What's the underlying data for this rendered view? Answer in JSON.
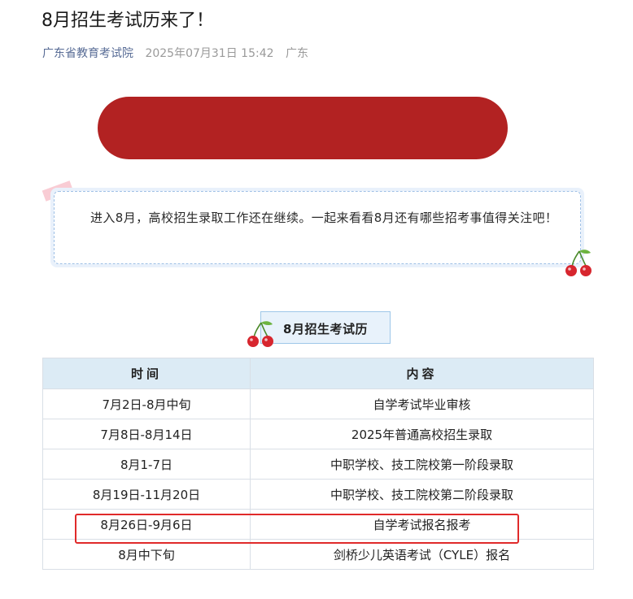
{
  "article": {
    "title": "8月招生考试历来了！",
    "author": "广东省教育考试院",
    "datetime": "2025年07月31日 15:42",
    "location": "广东"
  },
  "intro": {
    "text": "进入8月，高校招生录取工作还在继续。一起来看看8月还有哪些招考事值得关注吧！"
  },
  "calendar": {
    "title": "8月招生考试历",
    "headers": [
      "时间",
      "内容"
    ],
    "rows": [
      {
        "time": "7月2日-8月中旬",
        "content": "自学考试毕业审核"
      },
      {
        "time": "7月8日-8月14日",
        "content": "2025年普通高校招生录取"
      },
      {
        "time": "8月1-7日",
        "content": "中职学校、技工院校第一阶段录取"
      },
      {
        "time": "8月19日-11月20日",
        "content": "中职学校、技工院校第二阶段录取"
      },
      {
        "time": "8月26日-9月6日",
        "content": "自学考试报名报考"
      },
      {
        "time": "8月中下旬",
        "content": "剑桥少儿英语考试（CYLE）报名"
      }
    ],
    "highlighted_row_index": 4
  },
  "colors": {
    "banner_red": "#b22222",
    "author_link": "#576b95",
    "table_header_bg": "#dcebf5",
    "highlight_border": "#e02a2a"
  },
  "icons": {
    "decoration": "cherry-icon"
  }
}
